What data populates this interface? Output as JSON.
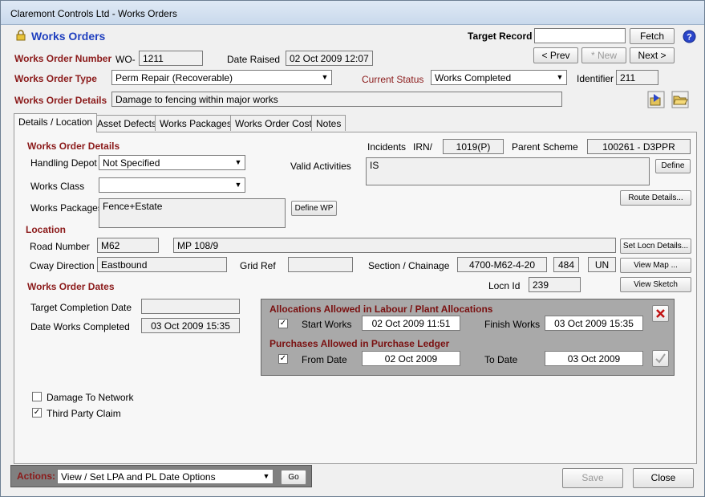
{
  "window": {
    "title": "Claremont Controls Ltd - Works Orders"
  },
  "header": {
    "form_title": "Works Orders",
    "target_record_label": "Target Record",
    "target_record_value": "",
    "fetch_label": "Fetch",
    "prev_label": "< Prev",
    "new_label": "* New",
    "next_label": "Next >"
  },
  "order": {
    "number_label": "Works Order Number",
    "prefix": "WO-",
    "number": "1211",
    "date_raised_label": "Date Raised",
    "date_raised": "02 Oct 2009 12:07",
    "type_label": "Works Order Type",
    "type": "Perm Repair (Recoverable)",
    "status_label": "Current Status",
    "status": "Works Completed",
    "identifier_label": "Identifier",
    "identifier": "211",
    "details_label": "Works Order Details",
    "details": "Damage to fencing within major works"
  },
  "tabs": [
    {
      "label": "Details / Location"
    },
    {
      "label": "Asset Defects"
    },
    {
      "label": "Works Packages"
    },
    {
      "label": "Works Order Costs"
    },
    {
      "label": "Notes"
    }
  ],
  "details": {
    "section_title": "Works Order Details",
    "handling_depot_label": "Handling Depot",
    "handling_depot": "Not Specified",
    "works_class_label": "Works Class",
    "works_class": "",
    "works_packages_label": "Works Packages",
    "works_packages": "Fence+Estate",
    "define_wp_label": "Define WP",
    "incidents_label": "Incidents",
    "irn_label": "IRN/",
    "irn": "1019(P)",
    "parent_scheme_label": "Parent Scheme",
    "parent_scheme": "100261 - D3PPR",
    "valid_activities_label": "Valid Activities",
    "valid_activities": "IS",
    "define_label": "Define",
    "route_details_label": "Route Details..."
  },
  "location": {
    "section_title": "Location",
    "road_number_label": "Road Number",
    "road_number": "M62",
    "road_desc": "MP 108/9",
    "set_locn_label": "Set Locn Details...",
    "cway_label": "Cway Direction",
    "cway": "Eastbound",
    "grid_ref_label": "Grid Ref",
    "grid_ref": "",
    "section_label": "Section / Chainage",
    "section": "4700-M62-4-20",
    "chainage": "484",
    "chainage_unit": "UN",
    "view_map_label": "View Map ...",
    "locn_id_label": "Locn Id",
    "locn_id": "239",
    "view_sketch_label": "View Sketch"
  },
  "dates": {
    "section_title": "Works Order Dates",
    "target_completion_label": "Target Completion Date",
    "target_completion": "",
    "date_completed_label": "Date Works Completed",
    "date_completed": "03 Oct 2009 15:35"
  },
  "allocations": {
    "title": "Allocations Allowed in Labour / Plant Allocations",
    "start_label": "Start Works",
    "start": "02 Oct 2009 11:51",
    "finish_label": "Finish Works",
    "finish": "03 Oct 2009 15:35",
    "purchases_title": "Purchases Allowed in Purchase Ledger",
    "from_label": "From Date",
    "from": "02 Oct 2009",
    "to_label": "To Date",
    "to": "03 Oct 2009"
  },
  "flags": {
    "damage_label": "Damage To Network",
    "third_party_label": "Third Party Claim"
  },
  "footer": {
    "actions_label": "Actions:",
    "action_value": "View / Set LPA and PL Date Options",
    "go_label": "Go",
    "save_label": "Save",
    "close_label": "Close"
  }
}
